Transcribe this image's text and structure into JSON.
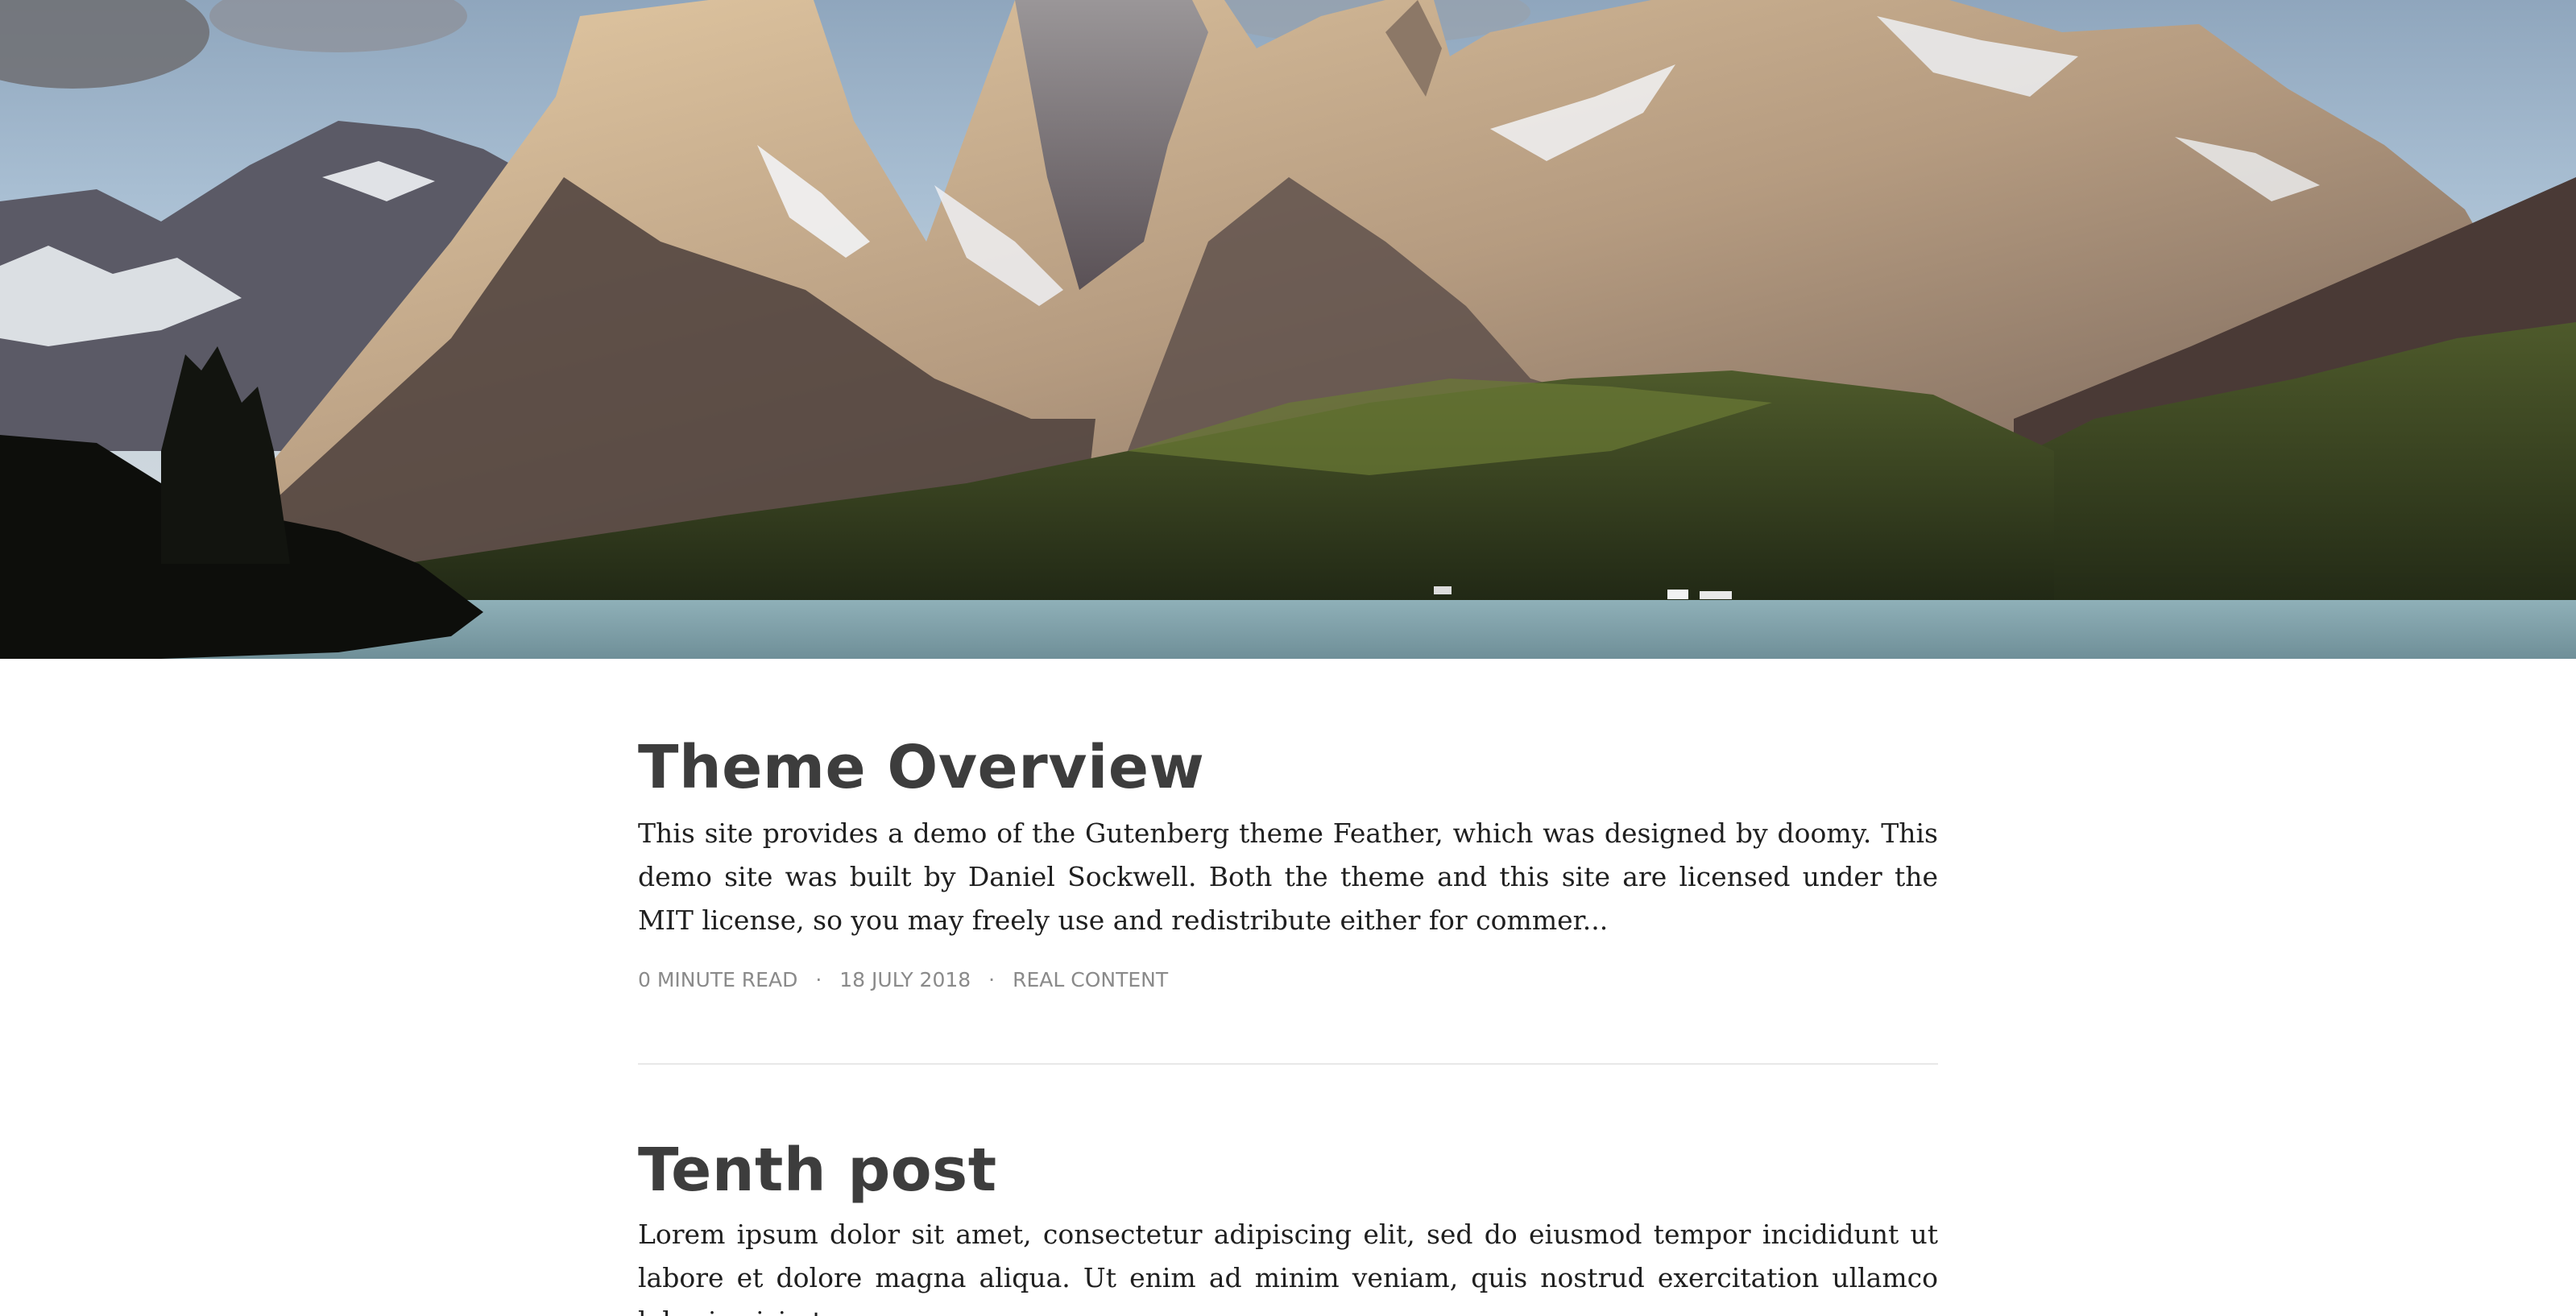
{
  "hero": {
    "image": "mountain-lake-landscape"
  },
  "posts": [
    {
      "title": "Theme Overview",
      "excerpt": "This site provides a demo of the Gutenberg theme Feather, which was designed by doomy. This demo site was built by Daniel Sockwell. Both the theme and this site are licensed under the MIT license, so you may freely use and redistribute either for commer...",
      "meta": {
        "read_time": "0 MINUTE READ",
        "separator": "·",
        "date": "18 JULY 2018",
        "category": "REAL CONTENT"
      }
    },
    {
      "title": "Tenth post",
      "excerpt": "Lorem ipsum dolor sit amet, consectetur adipiscing elit, sed do eiusmod tempor incididunt ut labore et dolore magna aliqua. Ut enim ad minim veniam, quis nostrud exercitation ullamco laboris nisi ut"
    }
  ],
  "colors": {
    "title": "#3d3d3d",
    "body_text": "#1f1f1f",
    "meta_text": "#8a8a8a",
    "divider": "#e8e8e8",
    "background": "#ffffff"
  }
}
